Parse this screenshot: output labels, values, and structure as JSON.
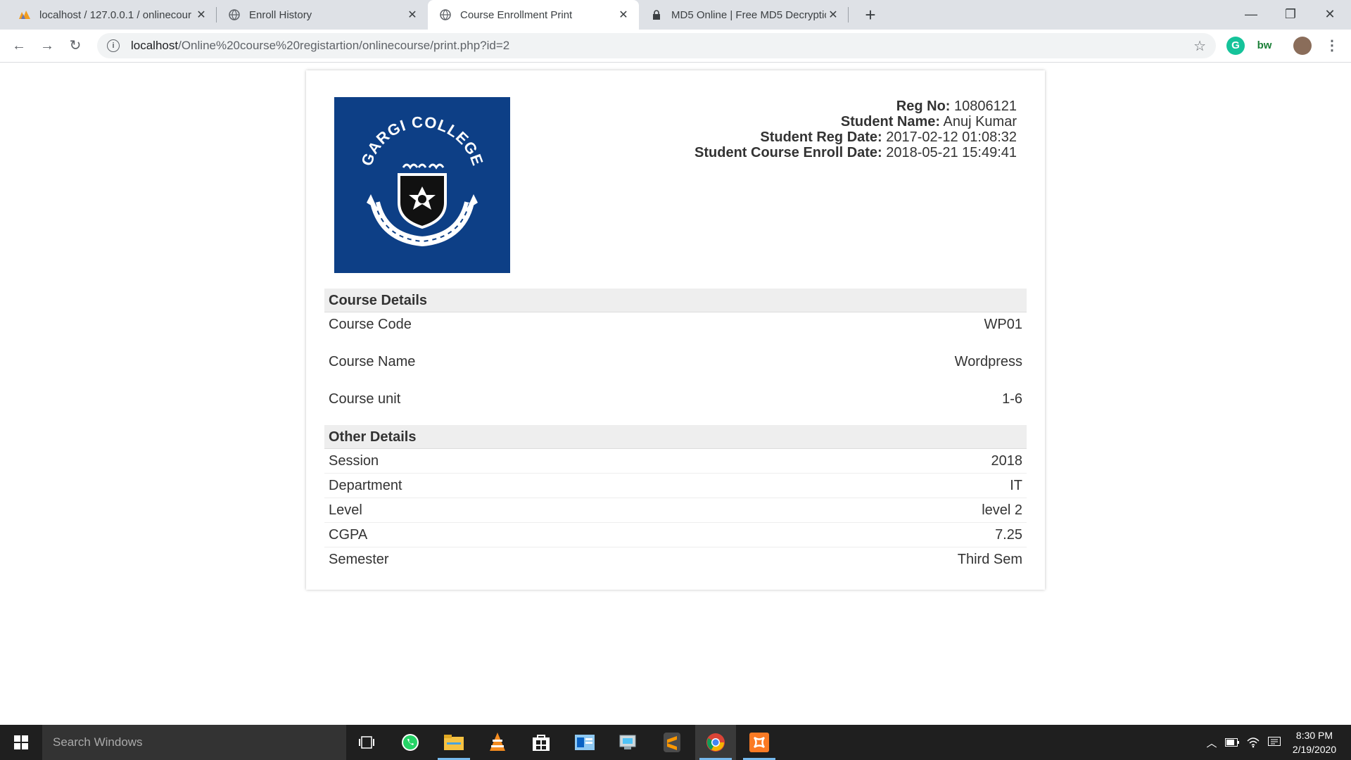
{
  "browser": {
    "tabs": [
      {
        "title": "localhost / 127.0.0.1 / onlinecour",
        "icon": "phpmyadmin-icon"
      },
      {
        "title": "Enroll History",
        "icon": "globe-icon"
      },
      {
        "title": "Course Enrollment Print",
        "icon": "globe-icon",
        "active": true
      },
      {
        "title": "MD5 Online | Free MD5 Decryptio",
        "icon": "lock-icon"
      }
    ],
    "url_host": "localhost",
    "url_path": "/Online%20course%20registartion/onlinecourse/print.php?id=2"
  },
  "page": {
    "logo_text": "GARGI COLLEGE",
    "meta": [
      {
        "label": "Reg No:",
        "value": "10806121"
      },
      {
        "label": "Student Name:",
        "value": "Anuj Kumar"
      },
      {
        "label": "Student Reg Date:",
        "value": "2017-02-12 01:08:32"
      },
      {
        "label": "Student Course Enroll Date:",
        "value": "2018-05-21 15:49:41"
      }
    ],
    "course_details": {
      "heading": "Course Details",
      "rows": [
        {
          "label": "Course Code",
          "value": "WP01"
        },
        {
          "label": "Course Name",
          "value": "Wordpress"
        },
        {
          "label": "Course unit",
          "value": "1-6"
        }
      ]
    },
    "other_details": {
      "heading": "Other Details",
      "rows": [
        {
          "label": "Session",
          "value": "2018"
        },
        {
          "label": "Department",
          "value": "IT"
        },
        {
          "label": "Level",
          "value": "level 2"
        },
        {
          "label": "CGPA",
          "value": "7.25"
        },
        {
          "label": "Semester",
          "value": "Third Sem"
        }
      ]
    }
  },
  "taskbar": {
    "search_placeholder": "Search Windows",
    "time": "8:30 PM",
    "date": "2/19/2020"
  }
}
